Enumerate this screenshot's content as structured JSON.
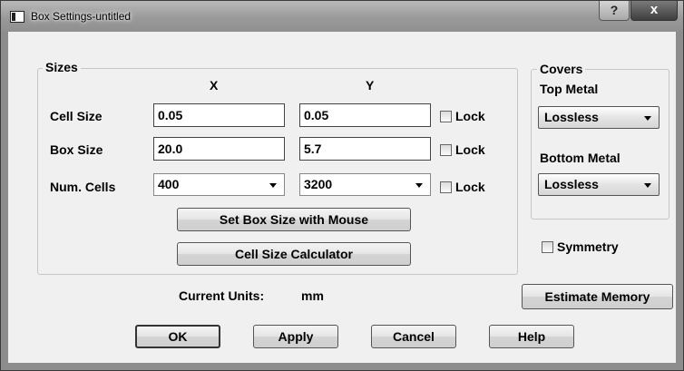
{
  "window": {
    "title": "Box Settings-untitled",
    "help_button": "?",
    "close_button": "x"
  },
  "sizes": {
    "group_label": "Sizes",
    "col_x": "X",
    "col_y": "Y",
    "rows": [
      {
        "label": "Cell Size",
        "x": "0.05",
        "y": "0.05",
        "lock_label": "Lock",
        "lock_checked": false
      },
      {
        "label": "Box Size",
        "x": "20.0",
        "y": "5.7",
        "lock_label": "Lock",
        "lock_checked": false
      },
      {
        "label": "Num. Cells",
        "x": "400",
        "y": "3200",
        "lock_label": "Lock",
        "lock_checked": false
      }
    ],
    "set_box_button": "Set Box Size with Mouse",
    "cell_calc_button": "Cell Size Calculator"
  },
  "covers": {
    "group_label": "Covers",
    "top_label": "Top Metal",
    "top_value": "Lossless",
    "bottom_label": "Bottom Metal",
    "bottom_value": "Lossless"
  },
  "symmetry": {
    "label": "Symmetry",
    "checked": false
  },
  "units": {
    "label": "Current Units:",
    "value": "mm"
  },
  "estimate_memory_button": "Estimate Memory",
  "footer": {
    "ok": "OK",
    "apply": "Apply",
    "cancel": "Cancel",
    "help": "Help"
  }
}
